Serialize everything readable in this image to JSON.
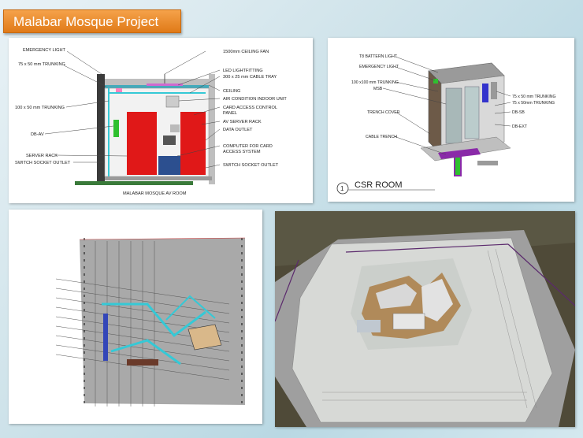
{
  "title": "Malabar Mosque Project",
  "av_room": {
    "caption": "MALABAR MOSQUE AV ROOM",
    "left_labels": [
      "EMERGENCY LIGHT",
      "75 x 50 mm TRUNKING",
      "100 x 50 mm TRUNKING",
      "DB-AV",
      "SERVER RACK",
      "SWITCH SOCKET OUTLET"
    ],
    "right_labels": [
      "1500mm CEILING FAN",
      "LED LIGHTFITTING",
      "300 x 25 mm CABLE TRAY",
      "CEILING",
      "AIR CONDITION INDOOR UNIT",
      "CARD ACCESS CONTROL",
      "PANEL",
      "AV SERVER RACK",
      "DATA OUTLET",
      "COMPUTER FOR CARD",
      "ACCESS SYSTEM",
      "SWITCH SOCKET OUTLET"
    ]
  },
  "csr_room": {
    "title_number": "1",
    "title": "CSR ROOM",
    "left_labels": [
      "T8 BATTERN LIGHT",
      "EMERGENCY LIGHT",
      "100 x100 mm TRUNKING",
      "MSB",
      "TRENCH COVER",
      "CABLE TRENCH"
    ],
    "right_labels": [
      "75 x 50 mm TRUNKING",
      "75 x 50mm TRUNKING",
      "DB-SB",
      "DB-EXT"
    ]
  },
  "colors": {
    "title_bg": "#e8892e",
    "rack_red": "#e01818",
    "trunking_cyan": "#35c9d6",
    "db_green": "#2fc02f"
  }
}
